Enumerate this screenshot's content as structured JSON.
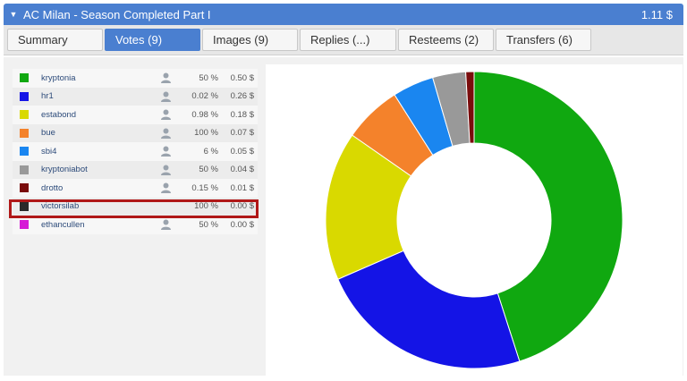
{
  "header": {
    "title": "AC Milan - Season Completed Part I",
    "payout": "1.11 $"
  },
  "tabs": [
    {
      "label": "Summary",
      "active": false
    },
    {
      "label": "Votes (9)",
      "active": true
    },
    {
      "label": "Images (9)",
      "active": false
    },
    {
      "label": "Replies (...)",
      "active": false
    },
    {
      "label": "Resteems (2)",
      "active": false
    },
    {
      "label": "Transfers (6)",
      "active": false
    }
  ],
  "votes": [
    {
      "voter": "kryptonia",
      "percent": "50 %",
      "value": "0.50 $",
      "color": "#10a810",
      "has_icon": true
    },
    {
      "voter": "hr1",
      "percent": "0.02 %",
      "value": "0.26 $",
      "color": "#1414e6",
      "has_icon": true
    },
    {
      "voter": "estabond",
      "percent": "0.98 %",
      "value": "0.18 $",
      "color": "#d9d900",
      "has_icon": true
    },
    {
      "voter": "bue",
      "percent": "100 %",
      "value": "0.07 $",
      "color": "#f4822b",
      "has_icon": true
    },
    {
      "voter": "sbi4",
      "percent": "6 %",
      "value": "0.05 $",
      "color": "#1a86f0",
      "has_icon": true
    },
    {
      "voter": "kryptoniabot",
      "percent": "50 %",
      "value": "0.04 $",
      "color": "#999999",
      "has_icon": true
    },
    {
      "voter": "drotto",
      "percent": "0.15 %",
      "value": "0.01 $",
      "color": "#7a0c0c",
      "has_icon": true
    },
    {
      "voter": "victorsilab",
      "percent": "100 %",
      "value": "0.00 $",
      "color": "#2a2a2a",
      "has_icon": false
    },
    {
      "voter": "ethancullen",
      "percent": "50 %",
      "value": "0.00 $",
      "color": "#d619d6",
      "has_icon": true
    }
  ],
  "chart_data": {
    "type": "pie",
    "donut": true,
    "categories": [
      "kryptonia",
      "hr1",
      "estabond",
      "bue",
      "sbi4",
      "kryptoniabot",
      "drotto",
      "victorsilab",
      "ethancullen"
    ],
    "values": [
      0.5,
      0.26,
      0.18,
      0.07,
      0.05,
      0.04,
      0.01,
      0.0,
      0.0
    ],
    "colors": [
      "#10a810",
      "#1414e6",
      "#d9d900",
      "#f4822b",
      "#1a86f0",
      "#999999",
      "#7a0c0c",
      "#2a2a2a",
      "#d619d6"
    ],
    "legend": "left"
  }
}
